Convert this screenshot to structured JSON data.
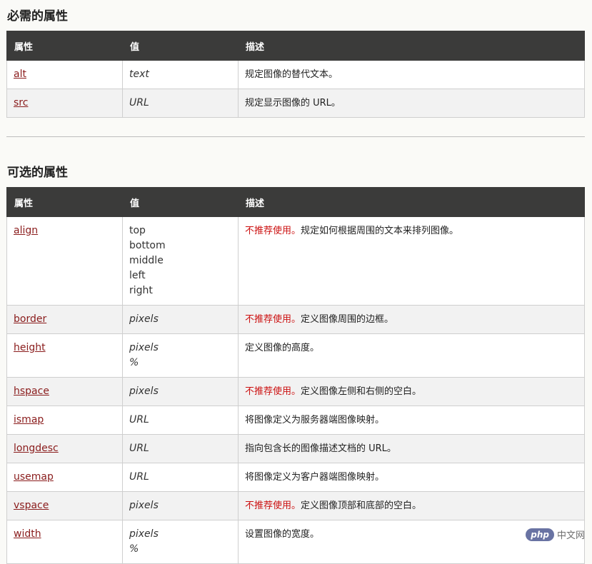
{
  "required": {
    "title": "必需的属性",
    "headers": [
      "属性",
      "值",
      "描述"
    ],
    "rows": [
      {
        "attr": "alt",
        "values": [
          "text"
        ],
        "deprecated": "",
        "desc": "规定图像的替代文本。"
      },
      {
        "attr": "src",
        "values": [
          "URL"
        ],
        "deprecated": "",
        "desc": "规定显示图像的 URL。"
      }
    ]
  },
  "optional": {
    "title": "可选的属性",
    "headers": [
      "属性",
      "值",
      "描述"
    ],
    "rows": [
      {
        "attr": "align",
        "values": [
          "top",
          "bottom",
          "middle",
          "left",
          "right"
        ],
        "deprecated": "不推荐使用。",
        "desc": "规定如何根据周围的文本来排列图像。"
      },
      {
        "attr": "border",
        "values": [
          "pixels"
        ],
        "deprecated": "不推荐使用。",
        "desc": "定义图像周围的边框。"
      },
      {
        "attr": "height",
        "values": [
          "pixels",
          "%"
        ],
        "deprecated": "",
        "desc": "定义图像的高度。"
      },
      {
        "attr": "hspace",
        "values": [
          "pixels"
        ],
        "deprecated": "不推荐使用。",
        "desc": "定义图像左侧和右侧的空白。"
      },
      {
        "attr": "ismap",
        "values": [
          "URL"
        ],
        "deprecated": "",
        "desc": "将图像定义为服务器端图像映射。"
      },
      {
        "attr": "longdesc",
        "values": [
          "URL"
        ],
        "deprecated": "",
        "desc": "指向包含长的图像描述文档的 URL。"
      },
      {
        "attr": "usemap",
        "values": [
          "URL"
        ],
        "deprecated": "",
        "desc": "将图像定义为客户器端图像映射。"
      },
      {
        "attr": "vspace",
        "values": [
          "pixels"
        ],
        "deprecated": "不推荐使用。",
        "desc": "定义图像顶部和底部的空白。"
      },
      {
        "attr": "width",
        "values": [
          "pixels",
          "%"
        ],
        "deprecated": "",
        "desc": "设置图像的宽度。"
      }
    ]
  },
  "watermark": {
    "badge": "php",
    "text": "中文网"
  }
}
